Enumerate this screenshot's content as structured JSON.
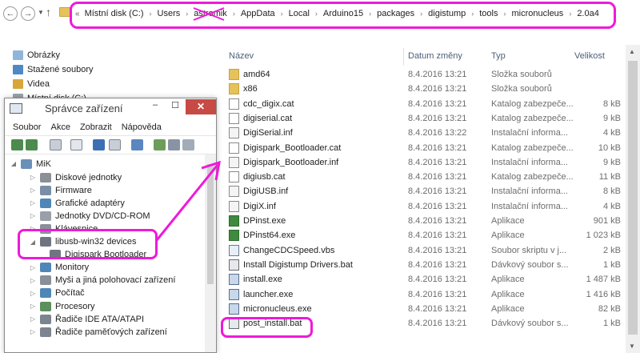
{
  "address_bar": {
    "chevron": "«",
    "segments": [
      "Místní disk (C:)",
      "Users",
      "astromik",
      "AppData",
      "Local",
      "Arduino15",
      "packages",
      "digistump",
      "tools",
      "micronucleus",
      "2.0a4"
    ],
    "icons": {
      "back": "arrow-left-icon",
      "forward": "arrow-right-icon",
      "dropdown": "chevron-down-icon",
      "up": "arrow-up-icon",
      "folder": "folder-icon"
    }
  },
  "nav_tree": {
    "items": [
      {
        "label": "Obrázky",
        "icon": "pictures-icon"
      },
      {
        "label": "Stažené soubory",
        "icon": "downloads-icon"
      },
      {
        "label": "Videa",
        "icon": "videos-icon"
      },
      {
        "label": "Místní disk (C:)",
        "icon": "drive-icon"
      }
    ]
  },
  "file_list": {
    "columns": {
      "name": "Název",
      "date": "Datum změny",
      "type": "Typ",
      "size": "Velikost"
    },
    "rows": [
      {
        "name": "amd64",
        "date": "8.4.2016 13:21",
        "type": "Složka souborů",
        "size": "",
        "icon": "folder-icon"
      },
      {
        "name": "x86",
        "date": "8.4.2016 13:21",
        "type": "Složka souborů",
        "size": "",
        "icon": "folder-icon"
      },
      {
        "name": "cdc_digix.cat",
        "date": "8.4.2016 13:21",
        "type": "Katalog zabezpeče...",
        "size": "8 kB",
        "icon": "catalog-icon"
      },
      {
        "name": "digiserial.cat",
        "date": "8.4.2016 13:21",
        "type": "Katalog zabezpeče...",
        "size": "9 kB",
        "icon": "catalog-icon"
      },
      {
        "name": "DigiSerial.inf",
        "date": "8.4.2016 13:22",
        "type": "Instalační informa...",
        "size": "4 kB",
        "icon": "inf-icon"
      },
      {
        "name": "Digispark_Bootloader.cat",
        "date": "8.4.2016 13:21",
        "type": "Katalog zabezpeče...",
        "size": "10 kB",
        "icon": "catalog-icon"
      },
      {
        "name": "Digispark_Bootloader.inf",
        "date": "8.4.2016 13:21",
        "type": "Instalační informa...",
        "size": "9 kB",
        "icon": "inf-icon"
      },
      {
        "name": "digiusb.cat",
        "date": "8.4.2016 13:21",
        "type": "Katalog zabezpeče...",
        "size": "11 kB",
        "icon": "catalog-icon"
      },
      {
        "name": "DigiUSB.inf",
        "date": "8.4.2016 13:21",
        "type": "Instalační informa...",
        "size": "8 kB",
        "icon": "inf-icon"
      },
      {
        "name": "DigiX.inf",
        "date": "8.4.2016 13:21",
        "type": "Instalační informa...",
        "size": "4 kB",
        "icon": "inf-icon"
      },
      {
        "name": "DPinst.exe",
        "date": "8.4.2016 13:21",
        "type": "Aplikace",
        "size": "901 kB",
        "icon": "exe-icon"
      },
      {
        "name": "DPinst64.exe",
        "date": "8.4.2016 13:21",
        "type": "Aplikace",
        "size": "1 023 kB",
        "icon": "exe-icon"
      },
      {
        "name": "ChangeCDCSpeed.vbs",
        "date": "8.4.2016 13:21",
        "type": "Soubor skriptu v j...",
        "size": "2 kB",
        "icon": "script-icon"
      },
      {
        "name": "Install Digistump Drivers.bat",
        "date": "8.4.2016 13:21",
        "type": "Dávkový soubor s...",
        "size": "1 kB",
        "icon": "batch-icon"
      },
      {
        "name": "install.exe",
        "date": "8.4.2016 13:21",
        "type": "Aplikace",
        "size": "1 487 kB",
        "icon": "app-icon"
      },
      {
        "name": "launcher.exe",
        "date": "8.4.2016 13:21",
        "type": "Aplikace",
        "size": "1 416 kB",
        "icon": "app-icon"
      },
      {
        "name": "micronucleus.exe",
        "date": "8.4.2016 13:21",
        "type": "Aplikace",
        "size": "82 kB",
        "icon": "app-icon"
      },
      {
        "name": "post_install.bat",
        "date": "8.4.2016 13:21",
        "type": "Dávkový soubor s...",
        "size": "1 kB",
        "icon": "batch-icon"
      }
    ]
  },
  "device_manager": {
    "title": "Správce zařízení",
    "window_buttons": {
      "minimize": "‒",
      "maximize": "☐",
      "close": "✕"
    },
    "menu": [
      "Soubor",
      "Akce",
      "Zobrazit",
      "Nápověda"
    ],
    "toolbar_icons": [
      "back-icon",
      "forward-icon",
      "properties-icon",
      "list-icon",
      "help-icon",
      "view-icon",
      "scan-icon",
      "update-driver-icon",
      "disable-icon",
      "uninstall-icon"
    ],
    "tree": {
      "root": "MiK",
      "items": [
        {
          "label": "Diskové jednotky",
          "expander": "▷",
          "icon": "disk-drive-icon"
        },
        {
          "label": "Firmware",
          "expander": "▷",
          "icon": "firmware-icon"
        },
        {
          "label": "Grafické adaptéry",
          "expander": "▷",
          "icon": "display-adapter-icon"
        },
        {
          "label": "Jednotky DVD/CD-ROM",
          "expander": "▷",
          "icon": "dvd-icon"
        },
        {
          "label": "Klávesnice",
          "expander": "▷",
          "icon": "keyboard-icon"
        },
        {
          "label": "libusb-win32 devices",
          "expander": "◢",
          "icon": "usb-icon",
          "children": [
            {
              "label": "Digispark Bootloader",
              "icon": "usb-device-icon"
            }
          ]
        },
        {
          "label": "Monitory",
          "expander": "▷",
          "icon": "monitor-icon"
        },
        {
          "label": "Myši a jiná polohovací zařízení",
          "expander": "▷",
          "icon": "mouse-icon"
        },
        {
          "label": "Počítač",
          "expander": "▷",
          "icon": "computer-icon"
        },
        {
          "label": "Procesory",
          "expander": "▷",
          "icon": "cpu-icon"
        },
        {
          "label": "Řadiče IDE ATA/ATAPI",
          "expander": "▷",
          "icon": "ide-controller-icon"
        },
        {
          "label": "Řadiče paměťových zařízení",
          "expander": "▷",
          "icon": "storage-controller-icon"
        }
      ]
    }
  },
  "annotation_color": "#ee1ad9",
  "colors": {
    "folder": "#e6c25a",
    "close_button": "#c74a44",
    "header_text": "#4c607a",
    "secondary_text": "#6d6d6d"
  }
}
